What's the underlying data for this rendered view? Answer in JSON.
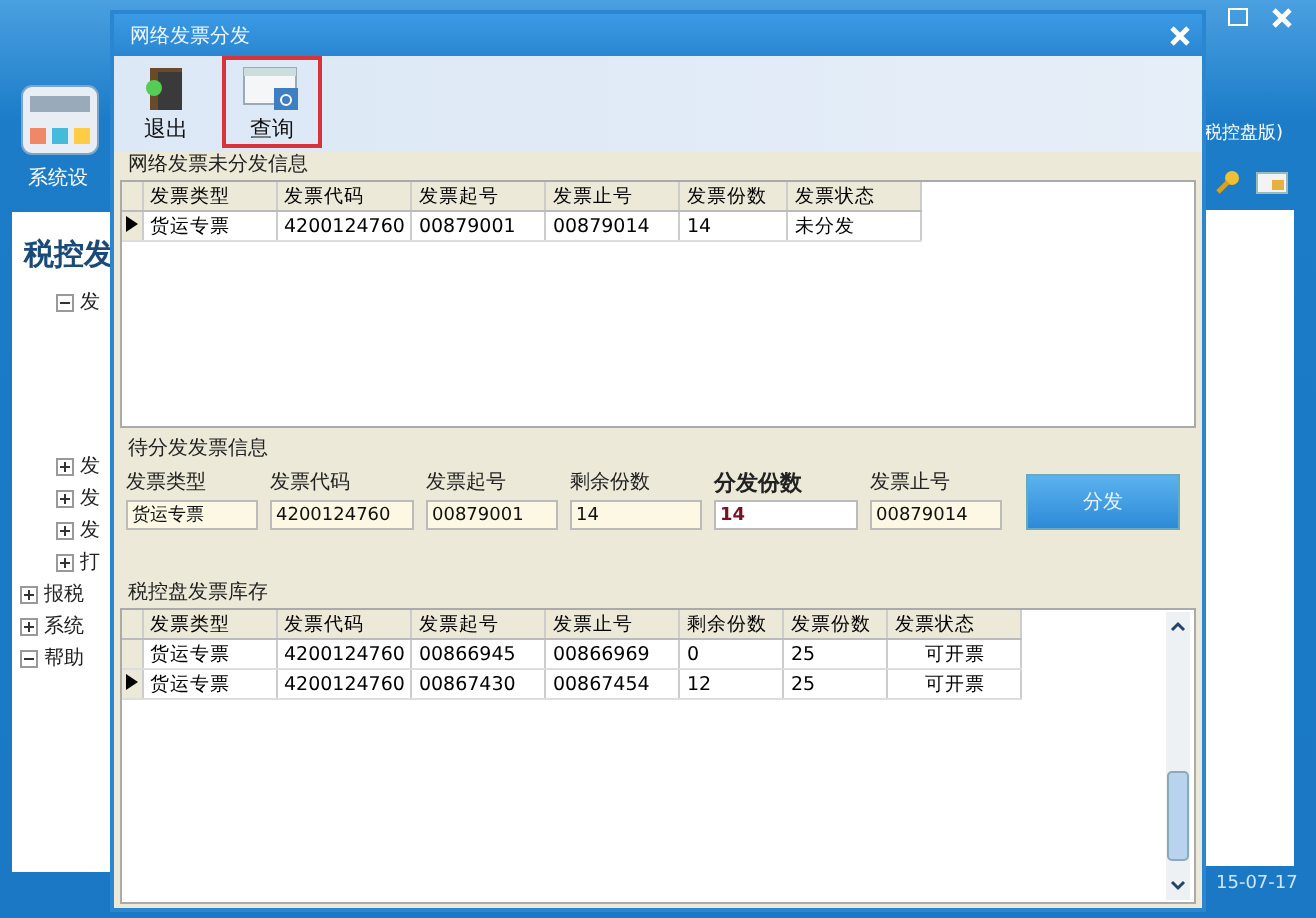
{
  "app": {
    "left_caption": "系统设",
    "left_title": "税控发",
    "right_caption": "税控盘版)",
    "date": "15-07-17",
    "tree": [
      {
        "label": "发",
        "expanded": true
      },
      {
        "label": "发",
        "expanded": false
      },
      {
        "label": "发",
        "expanded": false
      },
      {
        "label": "发",
        "expanded": false
      },
      {
        "label": "打",
        "expanded": false
      },
      {
        "label": "报税",
        "expanded": false
      },
      {
        "label": "系统",
        "expanded": false
      },
      {
        "label": "帮助",
        "expanded": true
      }
    ]
  },
  "window": {
    "title": "网络发票分发"
  },
  "toolbar": [
    {
      "label": "退出",
      "kind": "exit",
      "highlighted": false
    },
    {
      "label": "查询",
      "kind": "query",
      "highlighted": true
    }
  ],
  "undistributed": {
    "title": "网络发票未分发信息",
    "columns": [
      "发票类型",
      "发票代码",
      "发票起号",
      "发票止号",
      "发票份数",
      "发票状态"
    ],
    "rows": [
      {
        "selected": true,
        "cells": [
          "货运专票",
          "4200124760",
          "00879001",
          "00879014",
          "14",
          "未分发"
        ]
      }
    ]
  },
  "pending": {
    "title": "待分发发票信息",
    "fields": [
      {
        "label": "发票类型",
        "value": "货运专票",
        "emphasis": false
      },
      {
        "label": "发票代码",
        "value": "4200124760",
        "emphasis": false
      },
      {
        "label": "发票起号",
        "value": "00879001",
        "emphasis": false
      },
      {
        "label": "剩余份数",
        "value": "14",
        "emphasis": false
      },
      {
        "label": "分发份数",
        "value": "14",
        "emphasis": true
      },
      {
        "label": "发票止号",
        "value": "00879014",
        "emphasis": false
      }
    ],
    "button": "分发"
  },
  "stock": {
    "title": "税控盘发票库存",
    "columns": [
      "发票类型",
      "发票代码",
      "发票起号",
      "发票止号",
      "剩余份数",
      "发票份数",
      "发票状态"
    ],
    "rows": [
      {
        "selected": false,
        "cells": [
          "货运专票",
          "4200124760",
          "00866945",
          "00866969",
          "0",
          "25",
          "可开票"
        ]
      },
      {
        "selected": true,
        "cells": [
          "货运专票",
          "4200124760",
          "00867430",
          "00867454",
          "12",
          "25",
          "可开票"
        ]
      }
    ]
  }
}
